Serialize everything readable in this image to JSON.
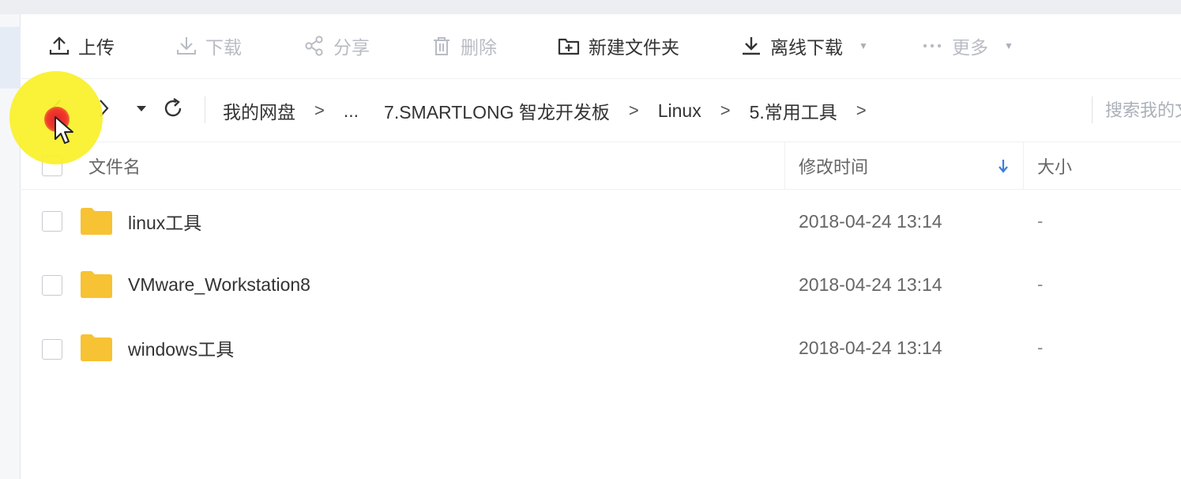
{
  "toolbar": {
    "upload": "上传",
    "download": "下载",
    "share": "分享",
    "delete": "删除",
    "new_folder": "新建文件夹",
    "offline_download": "离线下载",
    "more": "更多"
  },
  "breadcrumb": {
    "items": [
      "我的网盘",
      "...",
      "7.SMARTLONG 智龙开发板",
      "Linux",
      "5.常用工具"
    ],
    "separator": ">"
  },
  "search": {
    "placeholder": "搜索我的文件"
  },
  "table": {
    "columns": {
      "name": "文件名",
      "modified": "修改时间",
      "size": "大小"
    },
    "sort": {
      "column": "modified",
      "direction": "desc"
    },
    "rows": [
      {
        "name": "linux工具",
        "modified": "2018-04-24 13:14",
        "size": "-"
      },
      {
        "name": "VMware_Workstation8",
        "modified": "2018-04-24 13:14",
        "size": "-"
      },
      {
        "name": "windows工具",
        "modified": "2018-04-24 13:14",
        "size": "-"
      }
    ]
  },
  "colors": {
    "folder": "#f7c233",
    "accent": "#3d7ddb",
    "highlight": "#faf028",
    "disabled": "#b8bcc3"
  },
  "icons": {
    "upload": "upload-icon",
    "download": "download-icon",
    "share": "share-icon",
    "delete": "trash-icon",
    "new_folder": "folder-plus-icon",
    "offline_download": "offline-download-icon",
    "more": "more-dots-icon",
    "back": "chevron-left-icon",
    "forward": "chevron-right-icon",
    "history": "caret-down-icon",
    "refresh": "refresh-icon",
    "folder": "folder-icon",
    "sort": "sort-arrow-down-icon"
  }
}
